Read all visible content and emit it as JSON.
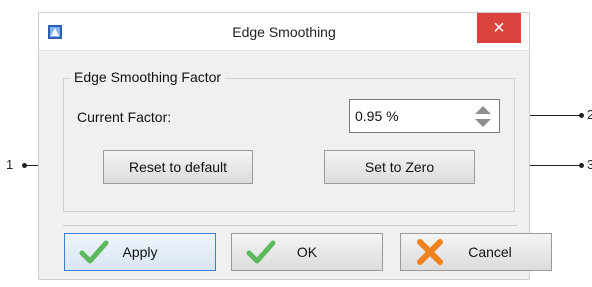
{
  "dialog": {
    "title": "Edge Smoothing",
    "close_glyph": "×",
    "group_label": "Edge Smoothing Factor",
    "factor_label": "Current Factor:",
    "factor_value": "0.95 %",
    "reset_label": "Reset to default",
    "zero_label": "Set to Zero",
    "apply_label": "Apply",
    "ok_label": "OK",
    "cancel_label": "Cancel"
  },
  "callouts": {
    "left": "1",
    "right_top": "2",
    "right_bottom": "3"
  },
  "icons": {
    "app": "app-icon",
    "check": "check-icon",
    "cancel": "x-icon"
  },
  "colors": {
    "close_bg": "#d9453c",
    "check_green": "#5cb85c",
    "cancel_orange": "#f0821e",
    "apply_border": "#3c7fd0"
  }
}
